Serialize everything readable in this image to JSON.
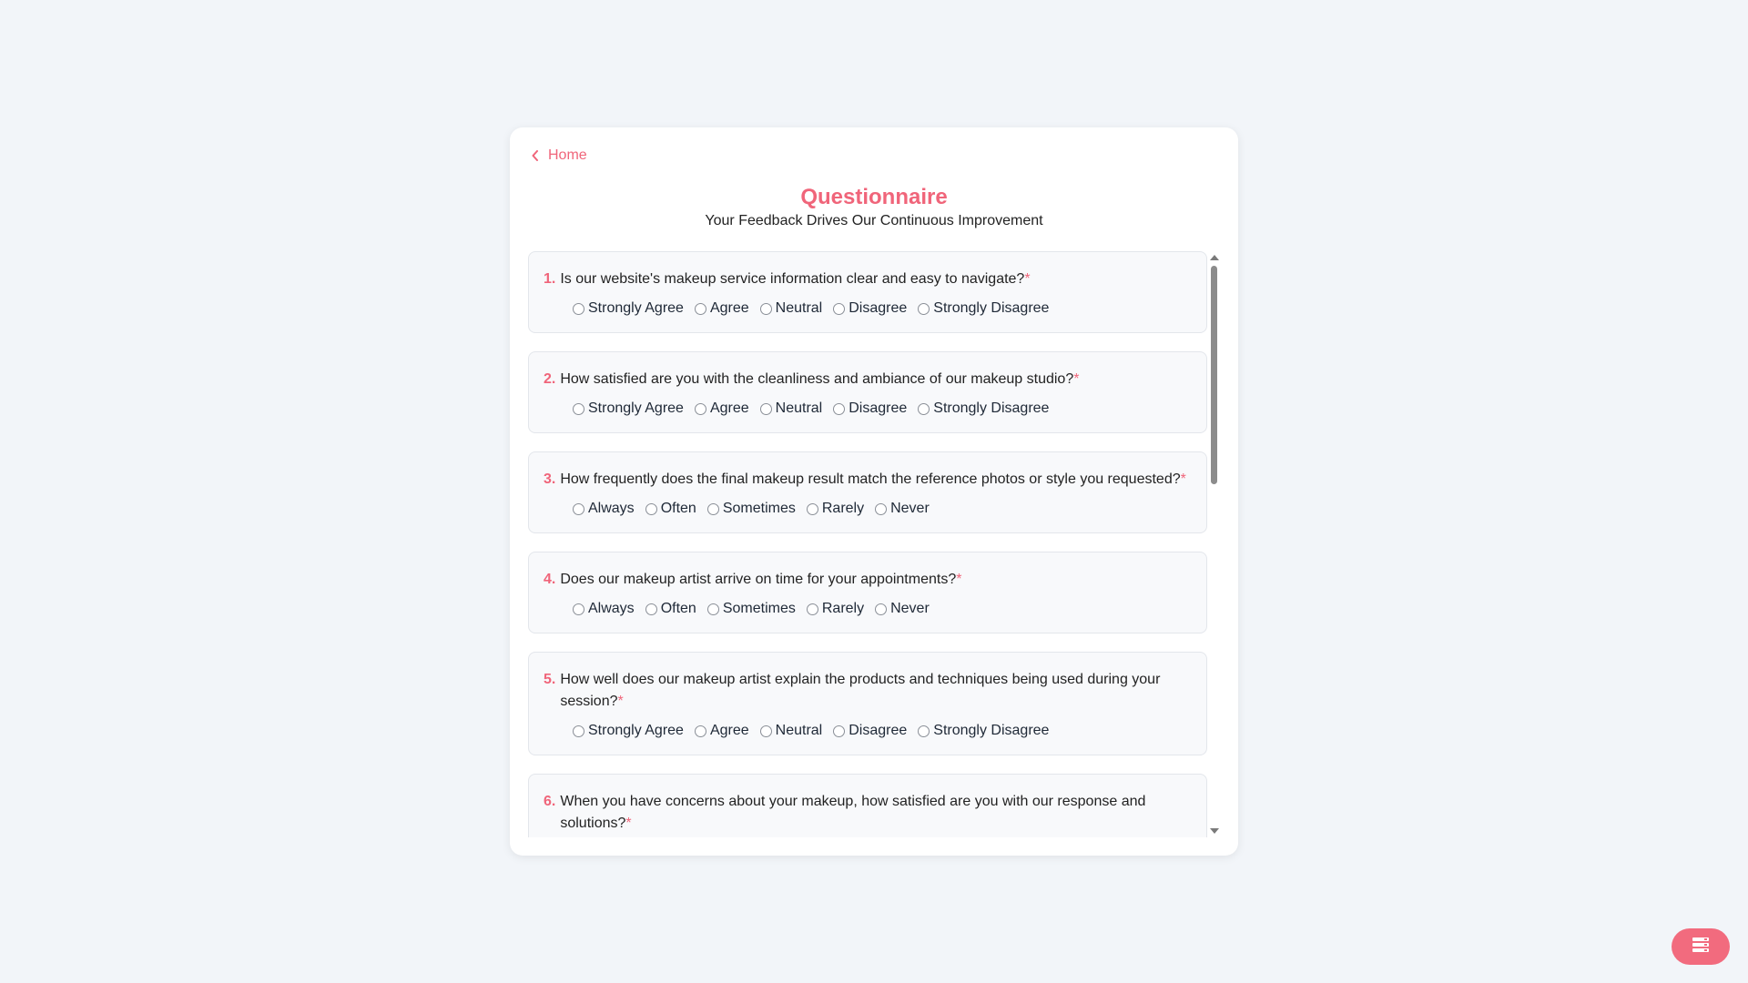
{
  "nav": {
    "home_label": "Home"
  },
  "header": {
    "title": "Questionnaire",
    "subtitle": "Your Feedback Drives Our Continuous Improvement"
  },
  "required_mark": "*",
  "questions": [
    {
      "number": "1.",
      "text": "Is our website's makeup service information clear and easy to navigate?",
      "options": [
        "Strongly Agree",
        "Agree",
        "Neutral",
        "Disagree",
        "Strongly Disagree"
      ]
    },
    {
      "number": "2.",
      "text": "How satisfied are you with the cleanliness and ambiance of our makeup studio?",
      "options": [
        "Strongly Agree",
        "Agree",
        "Neutral",
        "Disagree",
        "Strongly Disagree"
      ]
    },
    {
      "number": "3.",
      "text": "How frequently does the final makeup result match the reference photos or style you requested?",
      "options": [
        "Always",
        "Often",
        "Sometimes",
        "Rarely",
        "Never"
      ]
    },
    {
      "number": "4.",
      "text": "Does our makeup artist arrive on time for your appointments?",
      "options": [
        "Always",
        "Often",
        "Sometimes",
        "Rarely",
        "Never"
      ]
    },
    {
      "number": "5.",
      "text": "How well does our makeup artist explain the products and techniques being used during your session?",
      "options": [
        "Strongly Agree",
        "Agree",
        "Neutral",
        "Disagree",
        "Strongly Disagree"
      ]
    },
    {
      "number": "6.",
      "text": "When you have concerns about your makeup, how satisfied are you with our response and solutions?",
      "options": []
    }
  ],
  "icons": {
    "back": "chevron-left-icon",
    "menu": "menu-icon"
  },
  "colors": {
    "accent": "#f0657a",
    "background": "#f2f5f9",
    "card": "#ffffff",
    "question_bg": "#f8f9fb"
  }
}
